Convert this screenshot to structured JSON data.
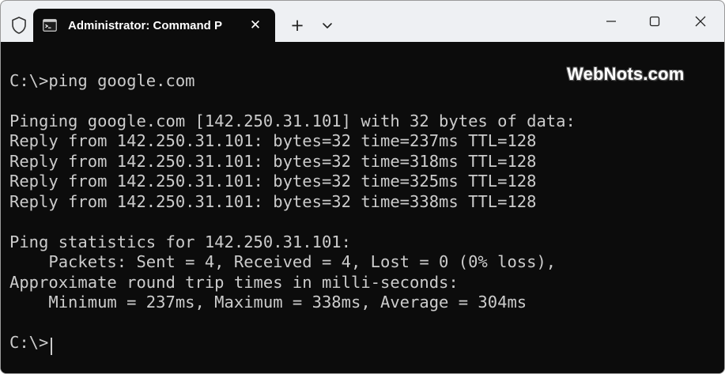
{
  "window": {
    "tab_title": "Administrator: Command P",
    "tab_close_symbol": "✕",
    "new_tab_symbol": "+",
    "controls": [
      "minimize",
      "maximize",
      "close"
    ]
  },
  "icons": {
    "shield": "shield-icon",
    "terminal": "terminal-app-icon",
    "dropdown": "chevron-down-icon",
    "minimize": "minimize-icon",
    "maximize": "maximize-icon",
    "close": "close-icon"
  },
  "terminal": {
    "lines": [
      "C:\\>ping google.com",
      "",
      "Pinging google.com [142.250.31.101] with 32 bytes of data:",
      "Reply from 142.250.31.101: bytes=32 time=237ms TTL=128",
      "Reply from 142.250.31.101: bytes=32 time=318ms TTL=128",
      "Reply from 142.250.31.101: bytes=32 time=325ms TTL=128",
      "Reply from 142.250.31.101: bytes=32 time=338ms TTL=128",
      "",
      "Ping statistics for 142.250.31.101:",
      "    Packets: Sent = 4, Received = 4, Lost = 0 (0% loss),",
      "Approximate round trip times in milli-seconds:",
      "    Minimum = 237ms, Maximum = 338ms, Average = 304ms",
      "",
      "C:\\>"
    ]
  },
  "watermark": "WebNots.com",
  "colors": {
    "titlebar": "#eef0f3",
    "terminal_background": "#0c0c0c",
    "terminal_text": "#cccccc"
  }
}
